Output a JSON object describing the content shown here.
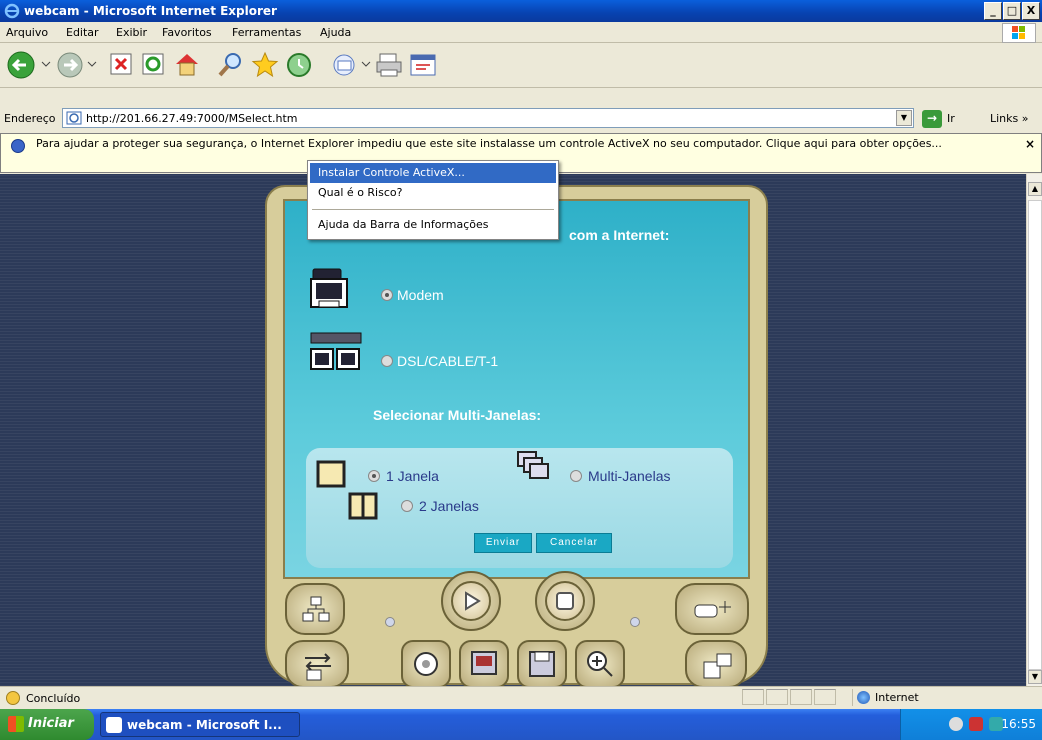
{
  "window": {
    "title": "webcam - Microsoft Internet Explorer",
    "min": "_",
    "max": "□",
    "close": "X"
  },
  "menu": [
    "Arquivo",
    "Editar",
    "Exibir",
    "Favoritos",
    "Ferramentas",
    "Ajuda"
  ],
  "address": {
    "label": "Endereço",
    "url": "http://201.66.27.49:7000/MSelect.htm",
    "go": "Ir",
    "links": "Links »"
  },
  "infobar": {
    "text": "Para ajudar a proteger sua segurança, o Internet Explorer impediu que este site instalasse um controle ActiveX no seu computador. Clique aqui para obter opções...",
    "close": "×"
  },
  "context_menu": {
    "items": [
      "Instalar Controle ActiveX...",
      "Qual é o Risco?",
      "Ajuda da Barra de Informações"
    ],
    "selected_index": 0
  },
  "device": {
    "connection_heading": "com a Internet:",
    "modem": "Modem",
    "dsl": "DSL/CABLE/T-1",
    "multi_heading": "Selecionar Multi-Janelas:",
    "one_window": "1 Janela",
    "multi_windows": "Multi-Janelas",
    "two_windows": "2 Janelas",
    "send": "Enviar",
    "cancel": "Cancelar"
  },
  "status": {
    "text": "Concluído",
    "zone": "Internet"
  },
  "taskbar": {
    "start": "Iniciar",
    "task": "webcam - Microsoft I...",
    "clock": "16:55"
  },
  "colors": {
    "accent": "#316ac5",
    "title_bar": "#0842b0",
    "taskbar": "#245edb",
    "screen": "#2eb0c8"
  }
}
